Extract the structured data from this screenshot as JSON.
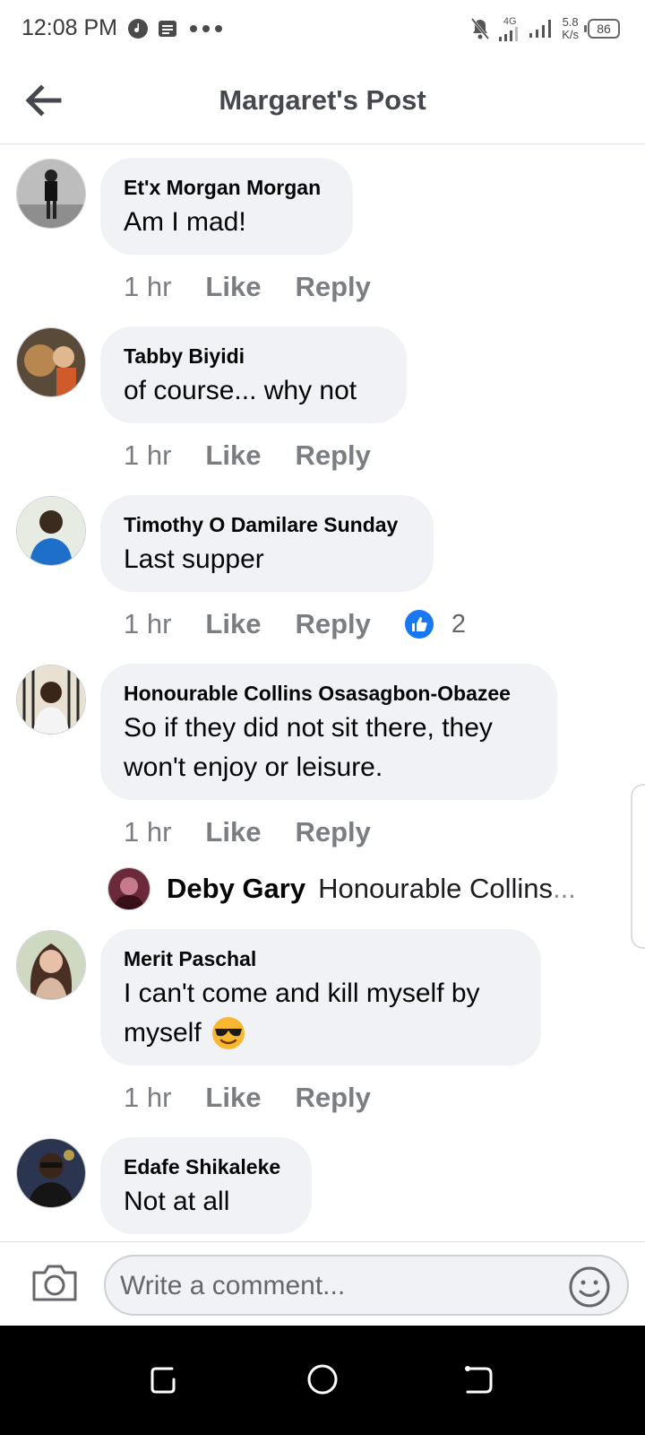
{
  "status_bar": {
    "time": "12:08 PM",
    "network": "4G",
    "speed_value": "5.8",
    "speed_unit": "K/s",
    "battery": "86"
  },
  "header": {
    "title": "Margaret's Post",
    "back_icon": "arrow-left-icon"
  },
  "comments": [
    {
      "name": "Et'x Morgan Morgan",
      "text_lines": [
        "Am I mad!"
      ],
      "time": "1 hr",
      "like_label": "Like",
      "reply_label": "Reply"
    },
    {
      "name": "Tabby Biyidi",
      "text_lines": [
        "of course... why not"
      ],
      "time": "1 hr",
      "like_label": "Like",
      "reply_label": "Reply"
    },
    {
      "name": "Timothy O Damilare Sunday",
      "text_lines": [
        "Last supper"
      ],
      "time": "1 hr",
      "like_label": "Like",
      "reply_label": "Reply",
      "reaction_count": "2"
    },
    {
      "name": "Honourable Collins Osasagbon-Obazee",
      "text_lines": [
        "So if they did not sit there,  they",
        "won't enjoy or leisure."
      ],
      "time": "1 hr",
      "like_label": "Like",
      "reply_label": "Reply",
      "reply_preview": {
        "name": "Deby Gary",
        "text": "Honourable Collins",
        "ellipsis": "..."
      }
    },
    {
      "name": "Merit Paschal",
      "text_lines": [
        "I can't come and kill myself by",
        "myself"
      ],
      "emoji": "smiling-face-with-sunglasses-icon",
      "time": "1 hr",
      "like_label": "Like",
      "reply_label": "Reply"
    },
    {
      "name": "Edafe Shikaleke",
      "text_lines": [
        "Not at all"
      ]
    }
  ],
  "composer": {
    "placeholder": "Write a comment..."
  },
  "colors": {
    "accent": "#1877f2",
    "bubble": "#f0f2f5",
    "muted_text": "#65676b"
  }
}
